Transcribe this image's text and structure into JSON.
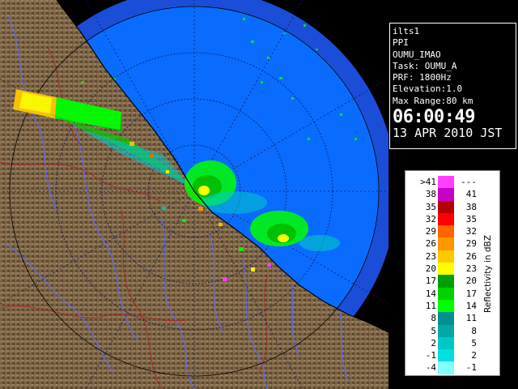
{
  "radar_info": {
    "site": "ilts1",
    "scan_type": "PPI",
    "radar_name": "OUMU_IMAO",
    "task": "Task: OUMU_A",
    "prf": "PRF: 1800Hz",
    "elevation": "Elevation:1.0",
    "max_range": "Max Range:80 km",
    "time": "06:00:49",
    "date": "13 APR 2010 JST"
  },
  "legend": {
    "title": "Reflectivity in dBZ",
    "rows": [
      {
        "lo": ">41",
        "hi": "---",
        "color": "#ff40ff"
      },
      {
        "lo": "38",
        "hi": "41",
        "color": "#c800c8"
      },
      {
        "lo": "35",
        "hi": "38",
        "color": "#b40000"
      },
      {
        "lo": "32",
        "hi": "35",
        "color": "#ff0000"
      },
      {
        "lo": "29",
        "hi": "32",
        "color": "#ff6400"
      },
      {
        "lo": "26",
        "hi": "29",
        "color": "#ff9600"
      },
      {
        "lo": "23",
        "hi": "26",
        "color": "#ffc800"
      },
      {
        "lo": "20",
        "hi": "23",
        "color": "#ffff00"
      },
      {
        "lo": "17",
        "hi": "20",
        "color": "#00a000"
      },
      {
        "lo": "14",
        "hi": "17",
        "color": "#00d200"
      },
      {
        "lo": "11",
        "hi": "14",
        "color": "#00ff00"
      },
      {
        "lo": "8",
        "hi": "11",
        "color": "#009090"
      },
      {
        "lo": "5",
        "hi": "8",
        "color": "#00a8a8"
      },
      {
        "lo": "2",
        "hi": "5",
        "color": "#00c8c8"
      },
      {
        "lo": "-1",
        "hi": "2",
        "color": "#00e0e0"
      },
      {
        "lo": "-4",
        "hi": "-1",
        "color": "#80ffff"
      }
    ]
  },
  "colors": {
    "outer_ring": "#1a4ed8",
    "scan_area": "#0a6cff",
    "land": "#7a6244",
    "echo_light": "#00ff00",
    "echo_mid": "#00c000",
    "echo_strong": "#ffff00"
  }
}
